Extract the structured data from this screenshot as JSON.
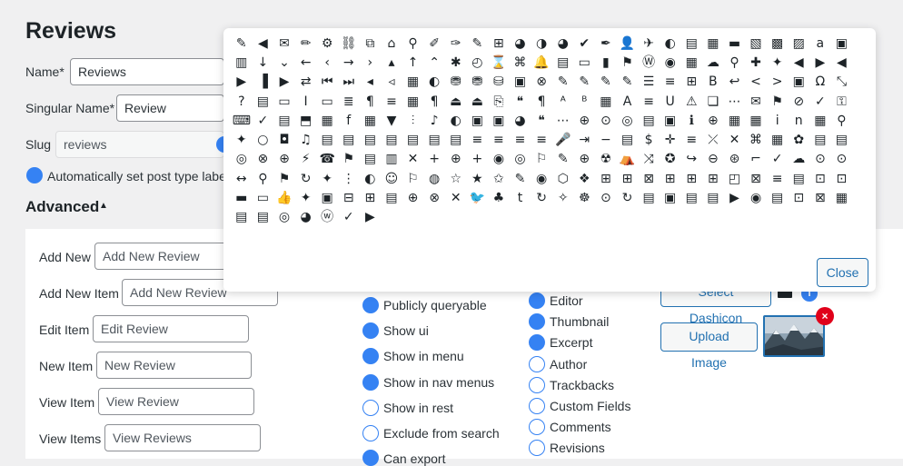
{
  "page": {
    "title": "Reviews"
  },
  "basic": {
    "name_label": "Name*",
    "name_value": "Reviews",
    "singular_label": "Singular Name*",
    "singular_value": "Review",
    "slug_label": "Slug",
    "slug_value": "reviews",
    "auto_label_text": "Automatically set post type label"
  },
  "advanced": {
    "title": "Advanced",
    "arrow": "▲",
    "labels": [
      {
        "label": "Add New",
        "placeholder": "Add New Review"
      },
      {
        "label": "Add New Item",
        "placeholder": "Add New Review"
      },
      {
        "label": "Edit Item",
        "placeholder": "Edit Review"
      },
      {
        "label": "New Item",
        "placeholder": "New Review"
      },
      {
        "label": "View Item",
        "placeholder": "View Review"
      },
      {
        "label": "View Items",
        "placeholder": "View Reviews"
      }
    ],
    "options": [
      {
        "label": "Publicly queryable",
        "checked": true
      },
      {
        "label": "Show ui",
        "checked": true
      },
      {
        "label": "Show in menu",
        "checked": true
      },
      {
        "label": "Show in nav menus",
        "checked": true
      },
      {
        "label": "Show in rest",
        "checked": false
      },
      {
        "label": "Exclude from search",
        "checked": false
      },
      {
        "label": "Can export",
        "checked": true
      }
    ],
    "supports": [
      {
        "label": "Editor",
        "checked": true
      },
      {
        "label": "Thumbnail",
        "checked": true
      },
      {
        "label": "Excerpt",
        "checked": true
      },
      {
        "label": "Author",
        "checked": false
      },
      {
        "label": "Trackbacks",
        "checked": false
      },
      {
        "label": "Custom Fields",
        "checked": false
      },
      {
        "label": "Comments",
        "checked": false
      },
      {
        "label": "Revisions",
        "checked": false
      }
    ],
    "select_dashicon_label": "Select Dashicon",
    "upload_image_label": "Upload Image",
    "info_icon": "i",
    "remove_icon": "×"
  },
  "picker": {
    "close_label": "Close",
    "icon_name": "dashicon",
    "glyphs": "✎◀✉✏⚙⛓⧉⌂⚲✐✑✎⊞◕◑◕✔✒👤✈◐▤▦▬▧▩▨a▣▥↓⌄←‹→›▴↑⌃✱◴⌛⌘🔔▤▭▮⚑Ⓦ◉▦☁⚲✚✦◀▶◀▶▐▶⇄⏮⏭◂◃▦◐⛃⛃⛁▣⊗✎✎✎✎☰≡⊞B↩<>▣Ω⤡?▤▭I▭≣¶≡▦¶⏏⏏⎘❝¶ᴬᴮ▦A≡U⚠❏⋯✉⚑⊘✓⚿⌨✓▤⬒▦f▦▼⫶♪◐▣▣◕❝⋯⊕⊙◎▤▣ℹ⊕▦▦in▦⚲✦○◘♫▤▤▤▤▤▤▤≡≡≡≡🎤⇥−▤$✛≡⤫✕⌘▦✿▤▤◎⊗⊕⚡☎⚑▤▥✕+⊕+◉◎⚐✎⊕☢⛺⤨✪↪⊖⊛⌐✓☁⊙⊙↔⚲⚑↻✦⋮◐☺⚐◍☆★✩✎◉⬡❖⊞⊞⊠⊞⊞⊞◰⊠≡▤⊡⊡▬▭👍✦▣⊟⊞▤⊕⊗✕🐦♣t↻✧☸⊙↻▤▣▤▤▶◉▤⊡⊠▦▤▤◎◕ⓦ✓▶"
  }
}
